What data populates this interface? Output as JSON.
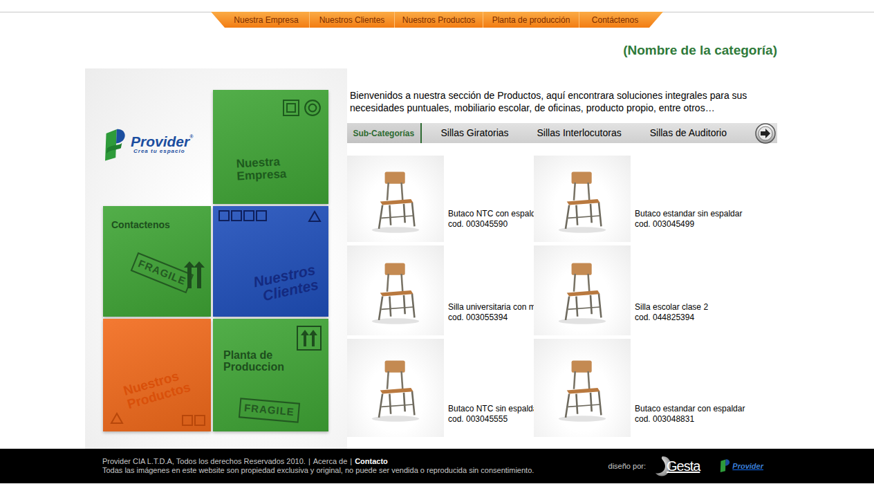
{
  "nav": [
    {
      "label": "Nuestra Empresa",
      "selected": false
    },
    {
      "label": "Nuestros Clientes",
      "selected": false
    },
    {
      "label": "Nuestros Productos",
      "selected": false
    },
    {
      "label": "Planta de producción",
      "selected": false
    },
    {
      "label": "Contáctenos",
      "selected": false
    }
  ],
  "heading": "(Nombre de la categoría)",
  "logo": {
    "name": "Provider",
    "registered": "®",
    "tagline": "Crea tu espacio"
  },
  "boxes": [
    {
      "lines": [
        "Nuestra",
        "Empresa"
      ],
      "color": "#3fa535"
    },
    {
      "lines": [
        "Contactenos"
      ],
      "color": "#3fa535",
      "stamp": "FRAGILE"
    },
    {
      "lines": [
        "Nuestros",
        "Clientes"
      ],
      "color": "#1f4fbb"
    },
    {
      "lines": [
        "Nuestros",
        "Productos"
      ],
      "color": "#f26a1b"
    },
    {
      "lines": [
        "Planta de",
        "Produccion"
      ],
      "color": "#3fa535",
      "stamp": "FRAGILE"
    }
  ],
  "intro": "Bienvenidos a nuestra sección de Productos, aquí encontrara soluciones integrales para sus necesidades puntuales, mobiliario escolar, de oficinas, producto propio, entre otros…",
  "subcategories": {
    "title": "Sub-Categorías",
    "items": [
      "Sillas Giratorias",
      "Sillas Interlocutoras",
      "Sillas de Auditorio"
    ]
  },
  "products": [
    {
      "name": "Butaco NTC con espaldar",
      "code": "cod. 003045590"
    },
    {
      "name": "Butaco estandar sin espaldar",
      "code": "cod. 003045499"
    },
    {
      "name": "Silla universitaria con mesa",
      "code": "cod. 003055394"
    },
    {
      "name": "Silla escolar clase 2",
      "code": "cod. 044825394"
    },
    {
      "name": "Butaco NTC sin espaldar",
      "code": "cod. 003045555"
    },
    {
      "name": "Butaco estandar con espaldar",
      "code": "cod. 003048831"
    }
  ],
  "footer": {
    "copyright": "Provider CIA  L.T.D.A, Todos los derechos Reservados 2010.",
    "separator": "|",
    "links": [
      {
        "label": "Acerca de",
        "emphasis": false
      },
      {
        "label": "Contacto",
        "emphasis": true
      }
    ],
    "notice": "Todas las imágenes en este website son propiedad exclusiva y original, no puede ser vendida o reproducida sin consentimiento."
  },
  "credits": {
    "label": "diseño por:",
    "designer": "Gesta",
    "client": "Provider"
  }
}
